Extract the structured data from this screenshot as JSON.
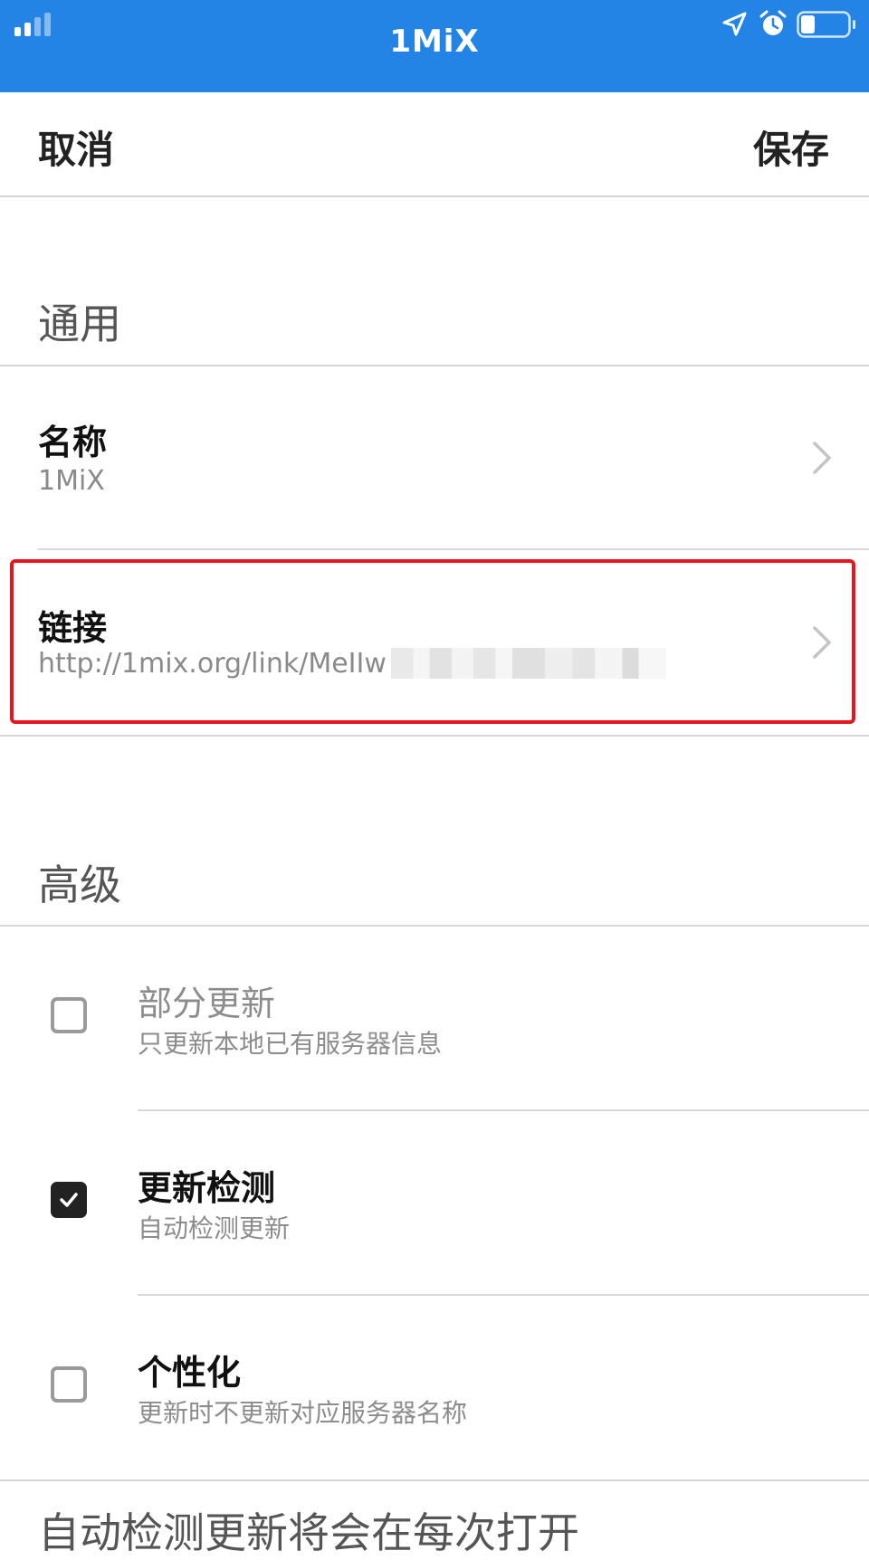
{
  "status_bar": {
    "app_name": "1MiX",
    "battery_level": 0.3,
    "icons": [
      "signal-icon",
      "location-arrow-icon",
      "alarm-clock-icon",
      "battery-icon"
    ]
  },
  "nav": {
    "cancel_label": "取消",
    "save_label": "保存"
  },
  "general": {
    "header": "通用",
    "name_title": "名称",
    "name_value": "1MiX",
    "link_title": "链接",
    "link_value": "http://1mix.org/link/MeIIw"
  },
  "advanced": {
    "header": "高级",
    "options": [
      {
        "title": "部分更新",
        "subtitle": "只更新本地已有服务器信息",
        "checked": false,
        "enabled": false
      },
      {
        "title": "更新检测",
        "subtitle": "自动检测更新",
        "checked": true,
        "enabled": true
      },
      {
        "title": "个性化",
        "subtitle": "更新时不更新对应服务器名称",
        "checked": false,
        "enabled": true
      }
    ]
  },
  "footer_note": "自动检测更新将会在每次打开",
  "colors": {
    "status_bar_bg": "#2384e6",
    "highlight_border": "#e8141e",
    "checked_box": "#222222"
  }
}
